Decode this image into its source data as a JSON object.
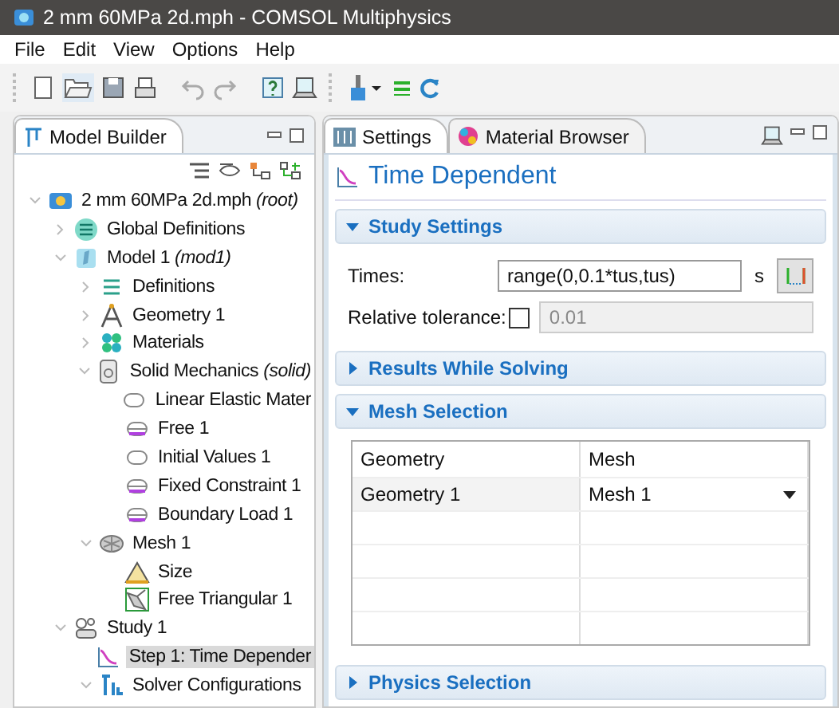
{
  "window": {
    "title": "2 mm 60MPa 2d.mph - COMSOL Multiphysics"
  },
  "menu": [
    "File",
    "Edit",
    "View",
    "Options",
    "Help"
  ],
  "model_builder": {
    "title": "Model Builder",
    "tree": [
      {
        "label": "2 mm 60MPa 2d.mph",
        "suffix": "(root)",
        "kind": "root",
        "expanded": true,
        "selected": false,
        "children": [
          {
            "label": "Global Definitions",
            "kind": "global",
            "expanded": false,
            "selected": false
          },
          {
            "label": "Model 1",
            "suffix": "(mod1)",
            "kind": "model",
            "expanded": true,
            "selected": false,
            "children": [
              {
                "label": "Definitions",
                "kind": "definitions",
                "expanded": false,
                "selected": false
              },
              {
                "label": "Geometry 1",
                "kind": "geometry",
                "expanded": false,
                "selected": false
              },
              {
                "label": "Materials",
                "kind": "materials",
                "expanded": false,
                "selected": false
              },
              {
                "label": "Solid Mechanics",
                "suffix": "(solid)",
                "kind": "physics",
                "expanded": true,
                "selected": false,
                "children": [
                  {
                    "label": "Linear Elastic Mater",
                    "kind": "node",
                    "selected": false
                  },
                  {
                    "label": "Free 1",
                    "kind": "boundary",
                    "selected": false
                  },
                  {
                    "label": "Initial Values 1",
                    "kind": "node",
                    "selected": false
                  },
                  {
                    "label": "Fixed Constraint 1",
                    "kind": "boundary",
                    "selected": false
                  },
                  {
                    "label": "Boundary Load 1",
                    "kind": "boundary",
                    "selected": false
                  }
                ]
              },
              {
                "label": "Mesh 1",
                "kind": "mesh",
                "expanded": true,
                "selected": false,
                "children": [
                  {
                    "label": "Size",
                    "kind": "size",
                    "selected": false
                  },
                  {
                    "label": "Free Triangular 1",
                    "kind": "triangular",
                    "selected": false
                  }
                ]
              }
            ]
          },
          {
            "label": "Study 1",
            "kind": "study",
            "expanded": true,
            "selected": false,
            "children": [
              {
                "label": "Step 1: Time Depender",
                "kind": "step",
                "selected": true
              },
              {
                "label": "Solver Configurations",
                "kind": "solver",
                "expanded": true,
                "selected": false
              }
            ]
          }
        ]
      }
    ]
  },
  "settings": {
    "tabs": [
      {
        "label": "Settings",
        "selected": true
      },
      {
        "label": "Material Browser",
        "selected": false
      }
    ],
    "heading": "Time Dependent",
    "sections": [
      {
        "kind": "study",
        "title": "Study Settings",
        "expanded": true,
        "times_label": "Times:",
        "times_value": "range(0,0.1*tus,tus)",
        "unit": "s",
        "tolerance_label": "Relative tolerance:",
        "tolerance_checked": false,
        "tolerance_value": "0.01"
      },
      {
        "title": "Results While Solving",
        "expanded": false
      },
      {
        "kind": "table",
        "title": "Mesh Selection",
        "expanded": true,
        "columns": [
          "Geometry",
          "Mesh"
        ],
        "rows": [
          [
            "Geometry 1",
            "Mesh 1"
          ]
        ]
      },
      {
        "title": "Physics Selection",
        "expanded": false
      }
    ]
  }
}
